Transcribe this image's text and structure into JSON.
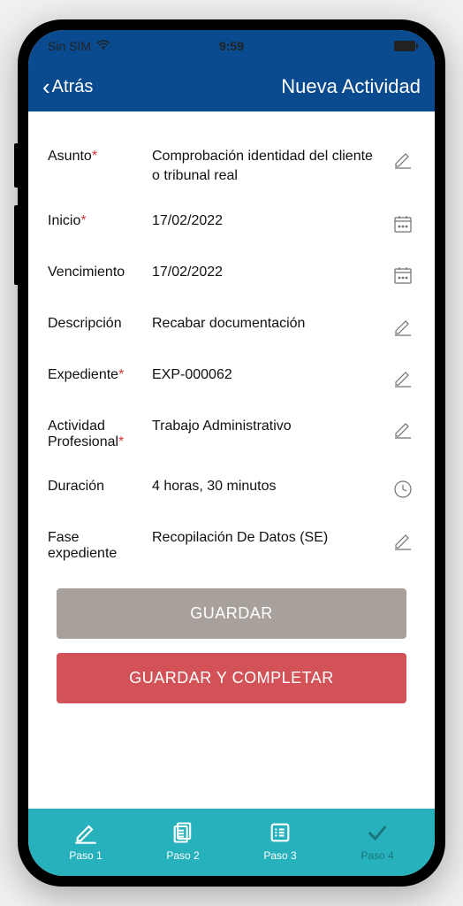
{
  "status": {
    "carrier": "Sin SIM",
    "time": "9:59"
  },
  "nav": {
    "back": "Atrás",
    "title": "Nueva Actividad"
  },
  "fields": {
    "asunto": {
      "label": "Asunto",
      "value": "Comprobación identidad del cliente o tribunal real"
    },
    "inicio": {
      "label": "Inicio",
      "value": "17/02/2022"
    },
    "vencimiento": {
      "label": "Vencimiento",
      "value": "17/02/2022"
    },
    "descripcion": {
      "label": "Descripción",
      "value": "Recabar documentación"
    },
    "expediente": {
      "label": "Expediente",
      "value": "EXP-000062"
    },
    "actividad": {
      "label": "Actividad Profesional",
      "value": "Trabajo Administrativo"
    },
    "duracion": {
      "label": "Duración",
      "value": "4 horas, 30 minutos"
    },
    "fase": {
      "label": "Fase expediente",
      "value": "Recopilación De Datos (SE)"
    }
  },
  "buttons": {
    "save": "GUARDAR",
    "complete": "GUARDAR Y COMPLETAR"
  },
  "tabs": {
    "step1": "Paso 1",
    "step2": "Paso 2",
    "step3": "Paso 3",
    "step4": "Paso 4"
  }
}
